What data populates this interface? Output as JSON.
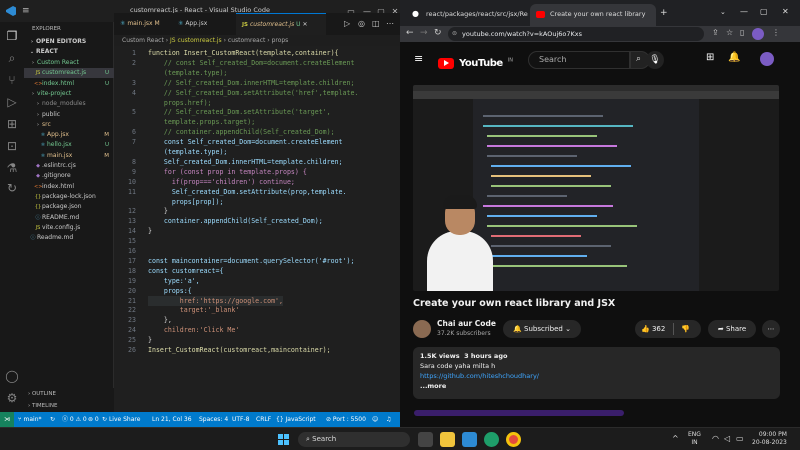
{
  "vscode": {
    "window_title": "customreact.js - React - Visual Studio Code",
    "explorer_header": "EXPLORER",
    "open_editors": "OPEN EDITORS",
    "workspace": "REACT",
    "tree": [
      {
        "name": "Custom React",
        "kind": "folder",
        "depth": 1,
        "badge": "",
        "badge_color": "#73c991"
      },
      {
        "name": "customreact.js",
        "kind": "js",
        "depth": 2,
        "badge": "U",
        "badge_color": "#73c991"
      },
      {
        "name": "index.html",
        "kind": "html",
        "depth": 2,
        "badge": "U",
        "badge_color": "#73c991"
      },
      {
        "name": "vite-project",
        "kind": "folder",
        "depth": 1,
        "badge": "",
        "badge_color": "#73c991"
      },
      {
        "name": "node_modules",
        "kind": "folder",
        "depth": 2,
        "badge": "",
        "badge_color": "#8b8b8b"
      },
      {
        "name": "public",
        "kind": "folder",
        "depth": 2,
        "badge": "",
        "badge_color": "#ccc"
      },
      {
        "name": "src",
        "kind": "folder",
        "depth": 2,
        "badge": "",
        "badge_color": "#e2c08d"
      },
      {
        "name": "App.jsx",
        "kind": "jsx",
        "depth": 3,
        "badge": "M",
        "badge_color": "#e2c08d"
      },
      {
        "name": "hello.jsx",
        "kind": "jsx",
        "depth": 3,
        "badge": "U",
        "badge_color": "#73c991"
      },
      {
        "name": "main.jsx",
        "kind": "jsx",
        "depth": 3,
        "badge": "M",
        "badge_color": "#e2c08d"
      },
      {
        "name": ".eslintrc.cjs",
        "kind": "cfg",
        "depth": 2,
        "badge": "",
        "badge_color": "#ccc"
      },
      {
        "name": ".gitignore",
        "kind": "cfg",
        "depth": 2,
        "badge": "",
        "badge_color": "#ccc"
      },
      {
        "name": "index.html",
        "kind": "html",
        "depth": 2,
        "badge": "",
        "badge_color": "#ccc"
      },
      {
        "name": "package-lock.json",
        "kind": "json",
        "depth": 2,
        "badge": "",
        "badge_color": "#ccc"
      },
      {
        "name": "package.json",
        "kind": "json",
        "depth": 2,
        "badge": "",
        "badge_color": "#ccc"
      },
      {
        "name": "README.md",
        "kind": "md",
        "depth": 2,
        "badge": "",
        "badge_color": "#ccc"
      },
      {
        "name": "vite.config.js",
        "kind": "js",
        "depth": 2,
        "badge": "",
        "badge_color": "#ccc"
      },
      {
        "name": "Readme.md",
        "kind": "md",
        "depth": 1,
        "badge": "",
        "badge_color": "#ccc"
      }
    ],
    "outline": "OUTLINE",
    "timeline": "TIMELINE",
    "tabs": [
      {
        "label": "main.jsx",
        "badge": "M",
        "active": false
      },
      {
        "label": "App.jsx",
        "badge": "",
        "active": false
      },
      {
        "label": "customreact.js",
        "badge": "U",
        "active": true
      }
    ],
    "breadcrumb": [
      "Custom React",
      "JS customreact.js",
      "customreact",
      "props"
    ],
    "code_lines": [
      {
        "n": "1",
        "t": "function Insert_CustomReact(template,container){",
        "c": "fn"
      },
      {
        "n": "2",
        "t": "    // const Self_created_Dom=document.createElement",
        "c": "cm"
      },
      {
        "n": "",
        "t": "    (template.type);",
        "c": "cm"
      },
      {
        "n": "3",
        "t": "    // Self_created_Dom.innerHTML=template.children;",
        "c": "cm"
      },
      {
        "n": "4",
        "t": "    // Self_created_Dom.setAttribute('href',template.",
        "c": "cm"
      },
      {
        "n": "",
        "t": "    props.href);",
        "c": "cm"
      },
      {
        "n": "5",
        "t": "    // Self_created_Dom.setAttribute('target',",
        "c": "cm"
      },
      {
        "n": "",
        "t": "    template.props.target);",
        "c": "cm"
      },
      {
        "n": "6",
        "t": "    // container.appendChild(Self_created_Dom);",
        "c": "cm"
      },
      {
        "n": "7",
        "t": "    const Self_created_Dom=document.createElement",
        "c": "pr"
      },
      {
        "n": "",
        "t": "    (template.type);",
        "c": "pr"
      },
      {
        "n": "8",
        "t": "    Self_created_Dom.innerHTML=template.children;",
        "c": "pr"
      },
      {
        "n": "9",
        "t": "    for (const prop in template.props) {",
        "c": "ct"
      },
      {
        "n": "10",
        "t": "      if(prop==='children') continue;",
        "c": "ct"
      },
      {
        "n": "11",
        "t": "      Self_created_Dom.setAttribute(prop,template.",
        "c": "pr"
      },
      {
        "n": "",
        "t": "      props[prop]);",
        "c": "pr"
      },
      {
        "n": "12",
        "t": "    }",
        "c": "pl"
      },
      {
        "n": "13",
        "t": "    container.appendChild(Self_created_Dom);",
        "c": "pr"
      },
      {
        "n": "14",
        "t": "}",
        "c": "pl"
      },
      {
        "n": "15",
        "t": "",
        "c": "pl"
      },
      {
        "n": "16",
        "t": "",
        "c": "pl"
      },
      {
        "n": "17",
        "t": "const maincontainer=document.querySelector('#root');",
        "c": "pr"
      },
      {
        "n": "18",
        "t": "const customreact={",
        "c": "pr"
      },
      {
        "n": "19",
        "t": "    type:'a',",
        "c": "pr"
      },
      {
        "n": "20",
        "t": "    props:{",
        "c": "pr"
      },
      {
        "n": "21",
        "t": "        href:'https://google.com',",
        "c": "st"
      },
      {
        "n": "22",
        "t": "        target:'_blank'",
        "c": "st"
      },
      {
        "n": "23",
        "t": "    },",
        "c": "pl"
      },
      {
        "n": "24",
        "t": "    children:'Click Me'",
        "c": "st"
      },
      {
        "n": "25",
        "t": "}",
        "c": "pl"
      },
      {
        "n": "26",
        "t": "Insert_CustomReact(customreact,maincontainer);",
        "c": "fn"
      }
    ],
    "status": {
      "branch": "main*",
      "sync": "↻",
      "problems": "ⓧ 0 ⚠ 0",
      "ports": "⊚ 0",
      "live": "Live Share",
      "position": "Ln 21, Col 36",
      "spaces": "Spaces: 4",
      "encoding": "UTF-8",
      "eol": "CRLF",
      "lang": "{} JavaScript",
      "port": "⊘ Port : 5500"
    }
  },
  "chrome": {
    "tabs": [
      {
        "label": "react/packages/react/src/jsx/Rea",
        "active": false
      },
      {
        "label": "Create your own react library",
        "active": true
      }
    ],
    "url": "youtube.com/watch?v=kAOuj6o7Kxs",
    "yt_logo": "YouTube",
    "yt_region": "IN",
    "search_placeholder": "Search",
    "video_title": "Create your own react library and JSX",
    "channel": "Chai aur Code",
    "subscribers": "37.2K subscribers",
    "subscribed": "Subscribed",
    "likes": "362",
    "share": "Share",
    "views": "1.5K views",
    "uploaded": "3 hours ago",
    "description": "Sara code yaha milta h",
    "link": "https://github.com/hiteshchoudhary/",
    "more": "...more",
    "accent": "#ff0000"
  },
  "taskbar": {
    "search": "Search",
    "lang": "ENG",
    "region": "IN",
    "time": "09:00 PM",
    "date": "20-08-2023"
  }
}
